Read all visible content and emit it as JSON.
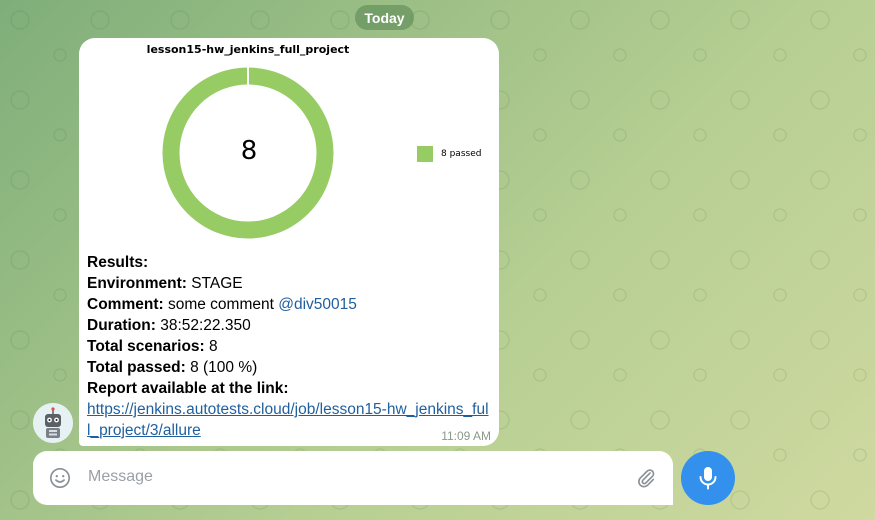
{
  "date_label": "Today",
  "chart": {
    "title": "lesson15-hw_jenkins_full_project",
    "center_value": "8",
    "legend_label": "8 passed",
    "color": "#97cc64"
  },
  "chart_data": {
    "type": "pie",
    "title": "lesson15-hw_jenkins_full_project",
    "categories": [
      "passed"
    ],
    "values": [
      8
    ],
    "legend": [
      "8 passed"
    ],
    "legend_position": "right"
  },
  "message": {
    "results_label": "Results:",
    "environment_label": "Environment:",
    "environment_value": "STAGE",
    "comment_label": "Comment:",
    "comment_value": "some comment",
    "mention": "@div50015",
    "duration_label": "Duration:",
    "duration_value": "38:52:22.350",
    "total_scenarios_label": "Total scenarios:",
    "total_scenarios_value": "8",
    "total_passed_label": "Total passed:",
    "total_passed_value": "8 (100 %)",
    "report_label": "Report available at the link:",
    "report_link": "https://jenkins.autotests.cloud/job/lesson15-hw_jenkins_full_project/3/allure",
    "time": "11:09 AM"
  },
  "composer": {
    "placeholder": "Message"
  },
  "icons": {
    "emoji": "smile-icon",
    "attach": "paperclip-icon",
    "mic": "microphone-icon",
    "avatar": "robot-avatar"
  },
  "colors": {
    "accent": "#3390ec",
    "link": "#1f5f9e",
    "chart_passed": "#97cc64"
  }
}
